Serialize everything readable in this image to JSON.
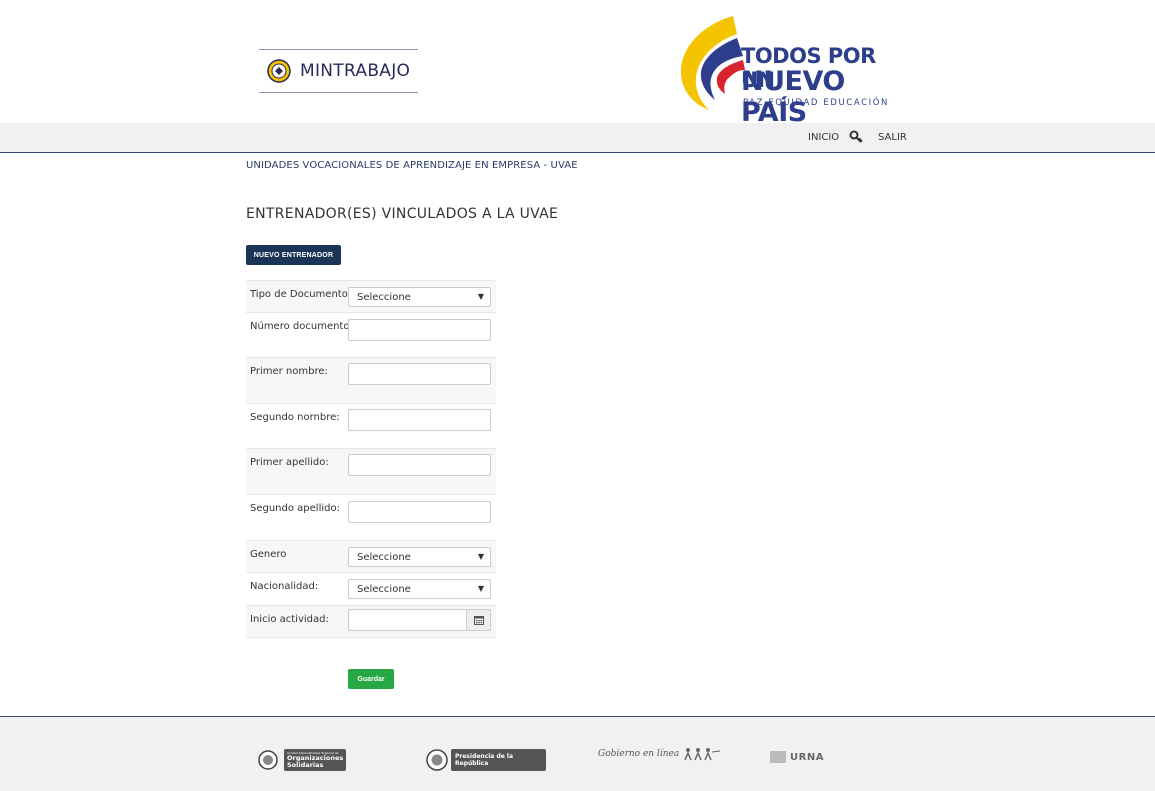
{
  "header": {
    "mintrabajo_logo": "MINTRABAJO",
    "campaign_logo": {
      "line1": "TODOS POR UN",
      "line2": "NUEVO PAÍS",
      "tagline": "PAZ  EQUIDAD  EDUCACIÓN"
    }
  },
  "nav": {
    "inicio": "INICIO",
    "key_icon": "key-icon",
    "salir": "SALIR"
  },
  "breadcrumb": "UNIDADES VOCACIONALES DE APRENDIZAJE EN EMPRESA - UVAE",
  "page_title": "ENTRENADOR(ES) VINCULADOS A LA UVAE",
  "buttons": {
    "nuevo_entrenador": "NUEVO ENTRENADOR",
    "guardar": "Guardar"
  },
  "form": {
    "tipo_documento": {
      "label": "Tipo de Documento",
      "value": "Seleccione"
    },
    "numero_documento": {
      "label": "Número documento:",
      "value": ""
    },
    "primer_nombre": {
      "label": "Primer nombre:",
      "value": ""
    },
    "segundo_nombre": {
      "label": "Segundo nornbre:",
      "value": ""
    },
    "primer_apellido": {
      "label": "Primer apellido:",
      "value": ""
    },
    "segundo_apellido": {
      "label": "Segundo apellido:",
      "value": ""
    },
    "genero": {
      "label": "Genero",
      "value": "Seleccione"
    },
    "nacionalidad": {
      "label": "Nacionalidad:",
      "value": "Seleccione"
    },
    "inicio_actividad": {
      "label": "Inicio actividad:",
      "value": ""
    }
  },
  "footer": {
    "org_solidarias": {
      "small": "Unidad Administrativa Especial de",
      "line1": "Organizaciones",
      "line2": "Solidarias"
    },
    "presidencia": "Presidencia de la República",
    "gobierno_en_linea": "Gobierno en línea",
    "urna": "URNA"
  },
  "colors": {
    "nav_border": "#3b4685",
    "btn_nuevo": "#1b3559",
    "btn_guardar": "#28a745",
    "logo_blue": "#2d3e8c"
  }
}
